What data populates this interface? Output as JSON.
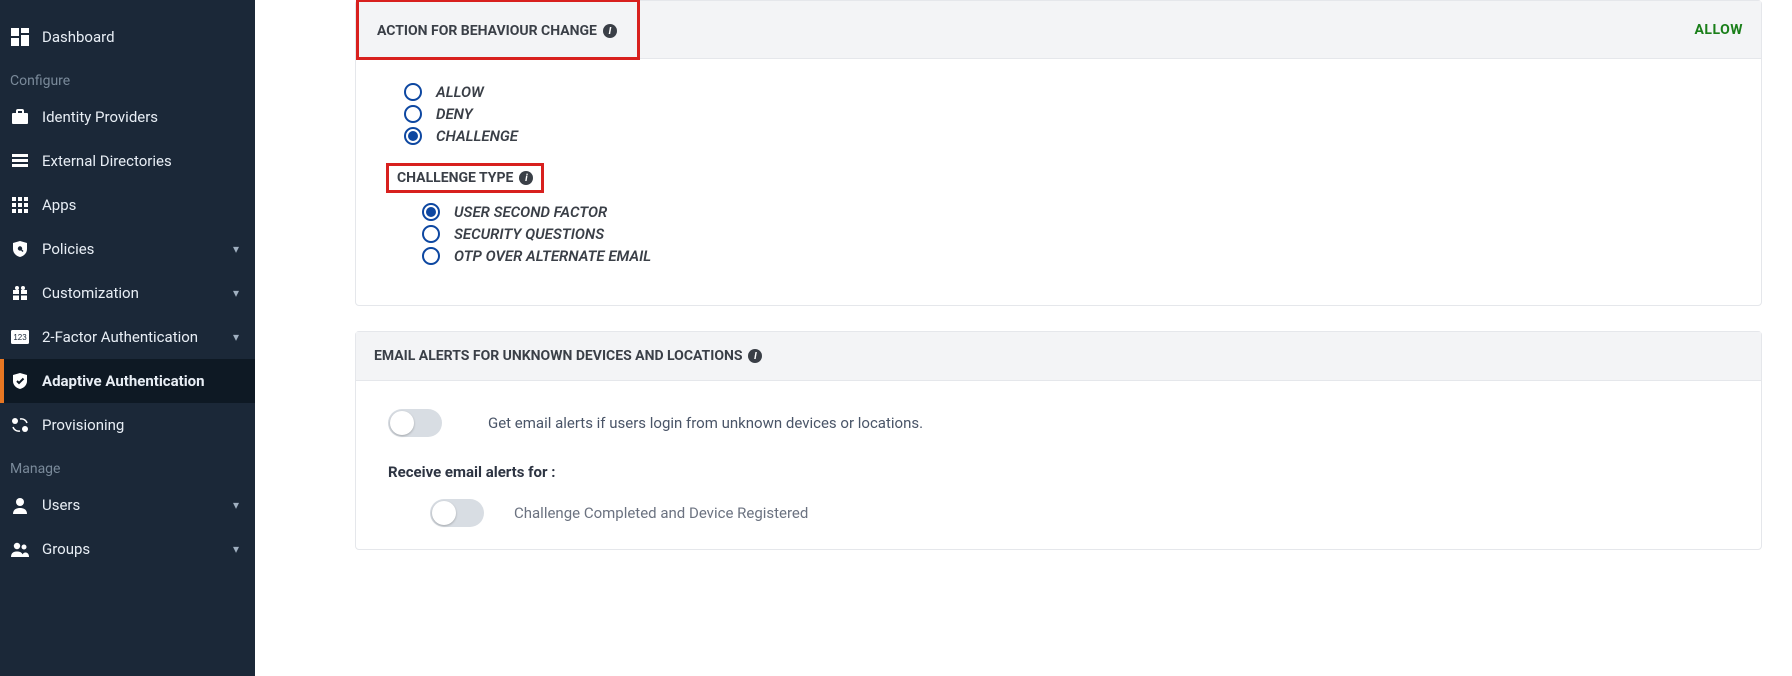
{
  "sidebar": {
    "items": [
      {
        "label": "Dashboard",
        "icon": "dashboard",
        "expandable": false
      },
      {
        "section": "Configure"
      },
      {
        "label": "Identity Providers",
        "icon": "idp",
        "expandable": false
      },
      {
        "label": "External Directories",
        "icon": "directories",
        "expandable": false
      },
      {
        "label": "Apps",
        "icon": "apps",
        "expandable": false
      },
      {
        "label": "Policies",
        "icon": "policies",
        "expandable": true
      },
      {
        "label": "Customization",
        "icon": "customization",
        "expandable": true
      },
      {
        "label": "2-Factor Authentication",
        "icon": "2fa",
        "expandable": true
      },
      {
        "label": "Adaptive Authentication",
        "icon": "shield",
        "expandable": false,
        "active": true
      },
      {
        "label": "Provisioning",
        "icon": "provisioning",
        "expandable": false
      },
      {
        "section": "Manage"
      },
      {
        "label": "Users",
        "icon": "users",
        "expandable": true
      },
      {
        "label": "Groups",
        "icon": "groups",
        "expandable": true
      }
    ]
  },
  "main": {
    "action_panel": {
      "title": "ACTION FOR BEHAVIOUR CHANGE",
      "status": "ALLOW",
      "actions": [
        {
          "label": "ALLOW",
          "selected": false
        },
        {
          "label": "DENY",
          "selected": false
        },
        {
          "label": "CHALLENGE",
          "selected": true
        }
      ],
      "challenge_title": "CHALLENGE TYPE",
      "challenge_types": [
        {
          "label": "USER SECOND FACTOR",
          "selected": true
        },
        {
          "label": "SECURITY QUESTIONS",
          "selected": false
        },
        {
          "label": "OTP OVER ALTERNATE EMAIL",
          "selected": false
        }
      ]
    },
    "email_panel": {
      "title": "EMAIL ALERTS FOR UNKNOWN DEVICES AND LOCATIONS",
      "toggle_text": "Get email alerts if users login from unknown devices or locations.",
      "receive_label": "Receive email alerts for :",
      "sub_toggles": [
        {
          "label": "Challenge Completed and Device Registered"
        }
      ]
    }
  }
}
